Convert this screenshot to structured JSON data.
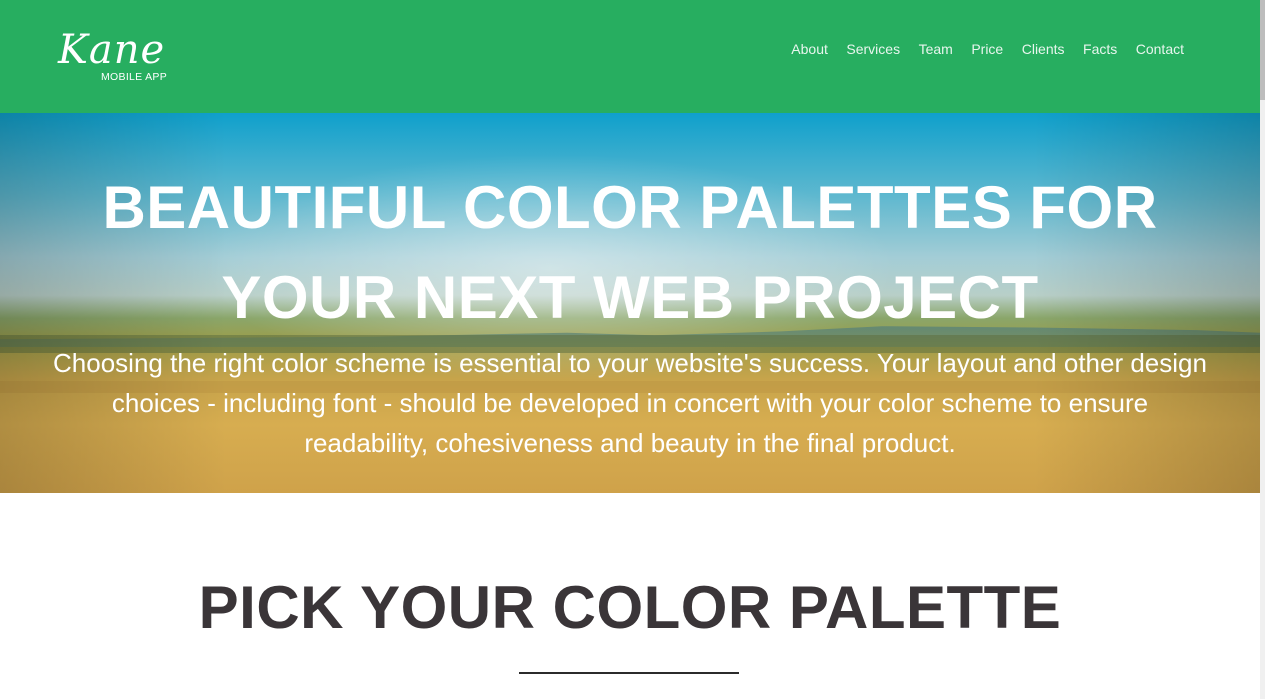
{
  "header": {
    "logo_script": "Kane",
    "logo_sub": "MOBILE APP",
    "nav": [
      "About",
      "Services",
      "Team",
      "Price",
      "Clients",
      "Facts",
      "Contact"
    ]
  },
  "hero": {
    "title_line1": "BEAUTIFUL COLOR PALETTES FOR",
    "title_line2": "YOUR NEXT WEB PROJECT",
    "text": "Choosing the right color scheme is essential to your website's success. Your layout and other design choices - including font - should be developed in concert with your color scheme to ensure readability, cohesiveness and beauty in the final product."
  },
  "section": {
    "title": "PICK YOUR COLOR PALETTE"
  },
  "colors": {
    "brand_green": "#27ae60",
    "heading_dark": "#3a3538"
  }
}
